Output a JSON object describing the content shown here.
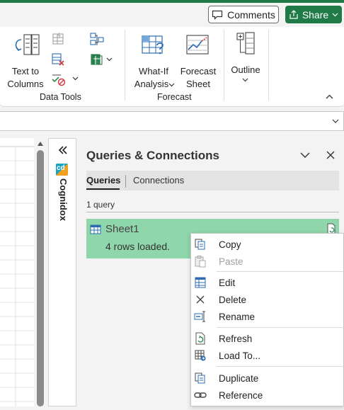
{
  "header": {
    "comments_label": "Comments",
    "share_label": "Share"
  },
  "ribbon": {
    "text_to_columns_line1": "Text to",
    "text_to_columns_line2": "Columns",
    "data_tools_label": "Data Tools",
    "whatif_line1": "What-If",
    "whatif_line2": "Analysis",
    "forecast_line1": "Forecast",
    "forecast_line2": "Sheet",
    "forecast_group_label": "Forecast",
    "outline_label": "Outline"
  },
  "cognidox": {
    "label": "Cognidox",
    "logo_text": "cd"
  },
  "pane": {
    "title": "Queries & Connections",
    "tabs": [
      {
        "label": "Queries"
      },
      {
        "label": "Connections"
      }
    ],
    "query_count": "1 query",
    "query": {
      "name": "Sheet1",
      "status": "4 rows loaded."
    }
  },
  "context_menu": {
    "items": [
      {
        "label": "Copy",
        "icon": "copy-icon",
        "enabled": true
      },
      {
        "label": "Paste",
        "icon": "paste-icon",
        "enabled": false
      },
      {
        "label": "Edit",
        "icon": "edit-icon",
        "enabled": true
      },
      {
        "label": "Delete",
        "icon": "delete-icon",
        "enabled": true
      },
      {
        "label": "Rename",
        "icon": "rename-icon",
        "enabled": true
      },
      {
        "label": "Refresh",
        "icon": "refresh-icon",
        "enabled": true
      },
      {
        "label": "Load To...",
        "icon": "load-to-icon",
        "enabled": true
      },
      {
        "label": "Duplicate",
        "icon": "duplicate-icon",
        "enabled": true
      },
      {
        "label": "Reference",
        "icon": "reference-icon",
        "enabled": true
      }
    ]
  },
  "colors": {
    "accent": "#1f7a45",
    "query_highlight": "#8fd6ab",
    "icon_blue": "#2b6cb0"
  }
}
